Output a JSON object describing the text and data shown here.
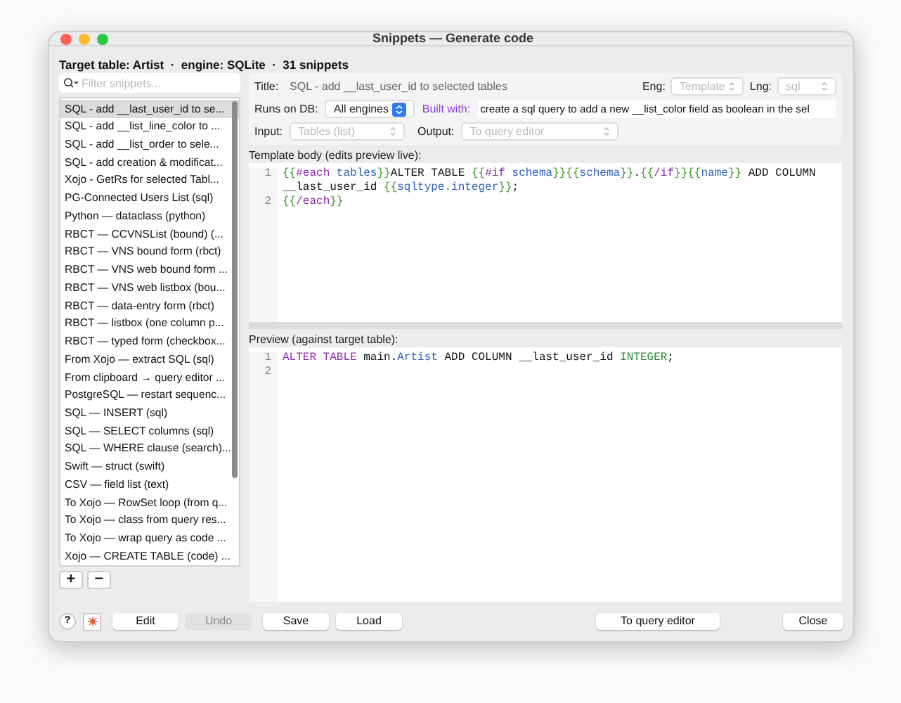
{
  "window": {
    "title": "Snippets — Generate code"
  },
  "header": "Target table: Artist  ·  engine: SQLite  ·  31 snippets",
  "filter": {
    "placeholder": "Filter snippets..."
  },
  "snippets": [
    {
      "label": "SQL - add __last_user_id to se...",
      "selected": true
    },
    {
      "label": "SQL - add __list_line_color to ...",
      "selected": false
    },
    {
      "label": "SQL - add __list_order to sele...",
      "selected": false
    },
    {
      "label": "SQL - add creation & modificat...",
      "selected": false
    },
    {
      "label": "Xojo - GetRs for selected Tabl...",
      "selected": false
    },
    {
      "label": "PG-Connected Users List  (sql)",
      "selected": false
    },
    {
      "label": "Python — dataclass  (python)",
      "selected": false
    },
    {
      "label": "RBCT — CCVNSList (bound)  (...",
      "selected": false
    },
    {
      "label": "RBCT — VNS bound form  (rbct)",
      "selected": false
    },
    {
      "label": "RBCT — VNS web bound form ...",
      "selected": false
    },
    {
      "label": "RBCT — VNS web listbox (bou...",
      "selected": false
    },
    {
      "label": "RBCT — data-entry form  (rbct)",
      "selected": false
    },
    {
      "label": "RBCT — listbox (one column p...",
      "selected": false
    },
    {
      "label": "RBCT — typed form (checkbox...",
      "selected": false
    },
    {
      "label": "From Xojo — extract SQL  (sql)",
      "selected": false
    },
    {
      "label": "From clipboard → query editor ...",
      "selected": false
    },
    {
      "label": "PostgreSQL — restart sequenc...",
      "selected": false
    },
    {
      "label": "SQL — INSERT  (sql)",
      "selected": false
    },
    {
      "label": "SQL — SELECT columns  (sql)",
      "selected": false
    },
    {
      "label": "SQL — WHERE clause (search)...",
      "selected": false
    },
    {
      "label": "Swift — struct  (swift)",
      "selected": false
    },
    {
      "label": "CSV — field list  (text)",
      "selected": false
    },
    {
      "label": "To Xojo — RowSet loop (from q...",
      "selected": false
    },
    {
      "label": "To Xojo — class from query res...",
      "selected": false
    },
    {
      "label": "To Xojo — wrap query as code ...",
      "selected": false
    },
    {
      "label": "Xojo — CREATE TABLE (code)  ...",
      "selected": false
    }
  ],
  "list_buttons": [
    "+",
    "−"
  ],
  "form": {
    "title_label": "Title:",
    "title_value": "SQL - add __last_user_id to selected tables",
    "eng_label": "Eng:",
    "eng": {
      "value": "Template",
      "disabled": true
    },
    "lng_label": "Lng:",
    "lng": {
      "value": "sql",
      "disabled": true
    },
    "runs_label": "Runs on DB:",
    "runs": {
      "value": "All engines",
      "disabled": false
    },
    "built_label": "Built with:",
    "built_value": "create a sql query to add a new __list_color field as boolean in the sel",
    "input_label": "Input:",
    "input": {
      "value": "Tables (list)",
      "disabled": true
    },
    "output_label": "Output:",
    "output": {
      "value": "To query editor",
      "disabled": true
    }
  },
  "template": {
    "label": "Template body (edits preview live):",
    "lines": [
      {
        "number": "1",
        "segments": [
          {
            "kind": "brace",
            "text": "{{"
          },
          {
            "kind": "keyword",
            "text": "#each"
          },
          {
            "kind": "var",
            "text": " tables"
          },
          {
            "kind": "brace",
            "text": "}}"
          },
          {
            "kind": "plain",
            "text": "ALTER TABLE "
          },
          {
            "kind": "brace",
            "text": "{{"
          },
          {
            "kind": "keyword",
            "text": "#if"
          },
          {
            "kind": "var",
            "text": " schema"
          },
          {
            "kind": "brace",
            "text": "}}{{"
          },
          {
            "kind": "var",
            "text": "schema"
          },
          {
            "kind": "brace",
            "text": "}}"
          },
          {
            "kind": "plain",
            "text": "."
          },
          {
            "kind": "brace",
            "text": "{{"
          },
          {
            "kind": "keyword",
            "text": "/if"
          },
          {
            "kind": "brace",
            "text": "}}{{"
          },
          {
            "kind": "var",
            "text": "name"
          },
          {
            "kind": "brace",
            "text": "}}"
          },
          {
            "kind": "plain",
            "text": " ADD COLUMN"
          }
        ]
      },
      {
        "segments": [
          {
            "kind": "plain",
            "text": "__last_user_id "
          },
          {
            "kind": "brace",
            "text": "{{"
          },
          {
            "kind": "var",
            "text": "sqltype.integer"
          },
          {
            "kind": "brace",
            "text": "}}"
          },
          {
            "kind": "plain",
            "text": ";"
          }
        ]
      },
      {
        "number": "2",
        "segments": [
          {
            "kind": "brace",
            "text": "{{"
          },
          {
            "kind": "keyword",
            "text": "/each"
          },
          {
            "kind": "brace",
            "text": "}}"
          }
        ]
      }
    ]
  },
  "preview": {
    "label": "Preview (against target table):",
    "lines": [
      {
        "number": "1",
        "segments": [
          {
            "kind": "keyword",
            "text": "ALTER TABLE"
          },
          {
            "kind": "plain",
            "text": " main."
          },
          {
            "kind": "var",
            "text": "Artist"
          },
          {
            "kind": "plain",
            "text": " ADD COLUMN __last_user_id "
          },
          {
            "kind": "type",
            "text": "INTEGER"
          },
          {
            "kind": "plain",
            "text": ";"
          }
        ]
      },
      {
        "number": "2"
      }
    ]
  },
  "help_button": "?",
  "buttons": [
    {
      "label": "Edit",
      "kind": "push",
      "disabled": false
    },
    {
      "label": "Undo",
      "kind": "push",
      "disabled": true
    },
    {
      "label": "Save",
      "kind": "push",
      "disabled": false
    },
    {
      "label": "Load",
      "kind": "push",
      "disabled": false
    },
    {
      "label": "To query editor",
      "kind": "push",
      "disabled": false
    },
    {
      "label": "Close",
      "kind": "push",
      "disabled": false
    }
  ]
}
